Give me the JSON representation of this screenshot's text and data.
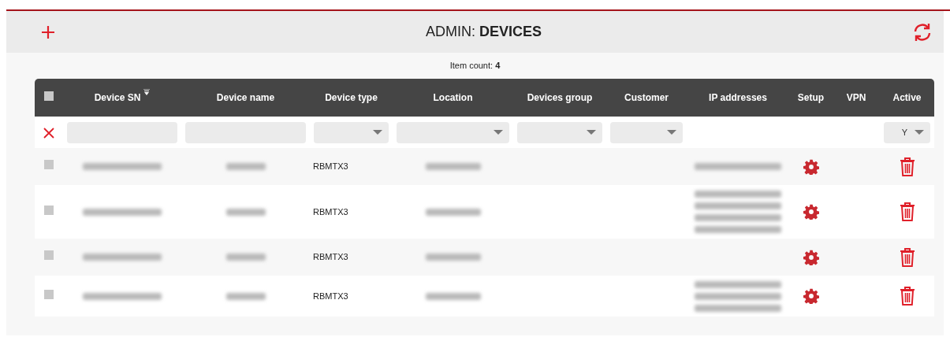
{
  "header": {
    "title_prefix": "ADMIN: ",
    "title_bold": "DEVICES"
  },
  "item_count": {
    "label": "Item count: ",
    "value": "4"
  },
  "table": {
    "columns": [
      {
        "selected": false
      },
      {
        "label": "Device SN",
        "sorted": true
      },
      {
        "label": "Device name"
      },
      {
        "label": "Device type"
      },
      {
        "label": "Location"
      },
      {
        "label": "Devices group"
      },
      {
        "label": "Customer"
      },
      {
        "label": "IP addresses"
      },
      {
        "label": "Setup"
      },
      {
        "label": "VPN"
      },
      {
        "label": "Active"
      }
    ],
    "filters": [
      {
        "kind": "clear"
      },
      {
        "kind": "text"
      },
      {
        "kind": "text"
      },
      {
        "kind": "select"
      },
      {
        "kind": "select"
      },
      {
        "kind": "select"
      },
      {
        "kind": "select"
      },
      {
        "kind": "none"
      },
      {
        "kind": "none"
      },
      {
        "kind": "none"
      },
      {
        "kind": "select",
        "value": "Y"
      }
    ],
    "rows": [
      {
        "selected": false,
        "sn": {
          "redacted": true
        },
        "name": {
          "redacted": true
        },
        "type": "RBMTX3",
        "location": {
          "redacted": true
        },
        "ip": [
          {
            "redacted": true
          }
        ]
      },
      {
        "selected": false,
        "sn": {
          "redacted": true
        },
        "name": {
          "redacted": true
        },
        "type": "RBMTX3",
        "location": {
          "redacted": true
        },
        "ip": [
          {
            "redacted": true
          },
          {
            "redacted": true
          },
          {
            "redacted": true
          },
          {
            "redacted": true
          }
        ]
      },
      {
        "selected": false,
        "sn": {
          "redacted": true
        },
        "name": {
          "redacted": true
        },
        "type": "RBMTX3",
        "location": {
          "redacted": true
        },
        "ip": []
      },
      {
        "selected": false,
        "sn": {
          "redacted": true
        },
        "name": {
          "redacted": true
        },
        "type": "RBMTX3",
        "location": {
          "redacted": true
        },
        "ip": [
          {
            "redacted": true
          },
          {
            "redacted": true
          },
          {
            "redacted": true
          }
        ]
      }
    ]
  }
}
